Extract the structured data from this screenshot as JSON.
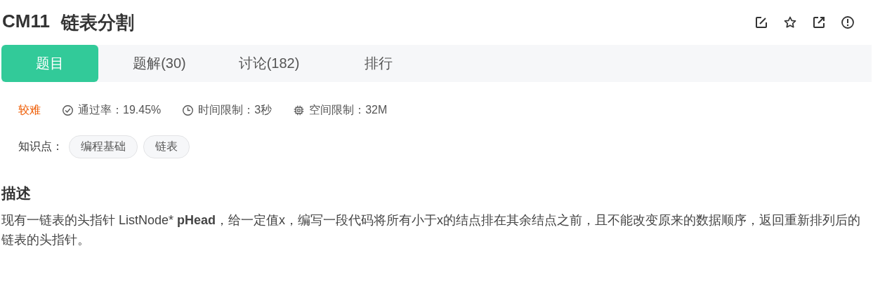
{
  "title": {
    "code": "CM11",
    "name": "链表分割"
  },
  "actions": [
    {
      "kind": "edit"
    },
    {
      "kind": "star"
    },
    {
      "kind": "share"
    },
    {
      "kind": "report"
    }
  ],
  "tabs": [
    {
      "label": "题目",
      "selected": true
    },
    {
      "label": "题解(30)",
      "selected": false
    },
    {
      "label": "讨论(182)",
      "selected": false
    },
    {
      "label": "排行",
      "selected": false
    }
  ],
  "difficulty": "较难",
  "stats": [
    {
      "kind": "pass",
      "text": "通过率：19.45%"
    },
    {
      "kind": "time",
      "text": "时间限制：3秒"
    },
    {
      "kind": "memory",
      "text": "空间限制：32M"
    }
  ],
  "knowledge": {
    "label": "知识点：",
    "tags": [
      "编程基础",
      "链表"
    ]
  },
  "description": {
    "heading": "描述",
    "text": "现有一链表的头指针 ListNode* **pHead**，给一定值x，编写一段代码将所有小于x的结点排在其余结点之前，且不能改变原来的数据顺序，返回重新排列后的链表的头指针。"
  }
}
